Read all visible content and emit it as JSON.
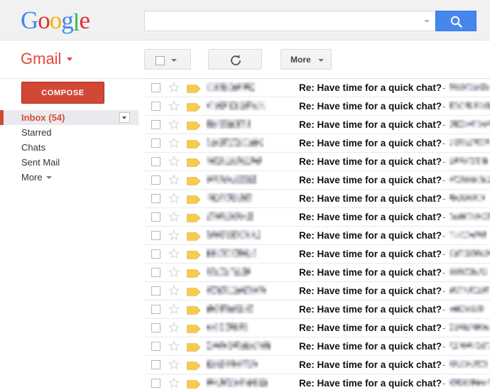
{
  "header": {
    "logo": {
      "text": "Google",
      "letters": [
        {
          "ch": "G",
          "color": "#4285f4"
        },
        {
          "ch": "o",
          "color": "#db3236"
        },
        {
          "ch": "o",
          "color": "#f4b400"
        },
        {
          "ch": "g",
          "color": "#4285f4"
        },
        {
          "ch": "l",
          "color": "#3cba54"
        },
        {
          "ch": "e",
          "color": "#db3236"
        }
      ]
    },
    "search": {
      "value": "",
      "placeholder": "",
      "button_icon": "search-icon",
      "options_icon": "chevron-down-icon"
    }
  },
  "app": {
    "name": "Gmail",
    "name_color": "#dd4b39",
    "caret_icon": "chevron-down-icon"
  },
  "toolbar": {
    "select_all": {
      "icon": "checkbox-icon",
      "caret": "chevron-down-icon"
    },
    "refresh": {
      "icon": "refresh-icon",
      "label": ""
    },
    "more": {
      "label": "More",
      "caret": "chevron-down-icon"
    }
  },
  "sidebar": {
    "compose_label": "COMPOSE",
    "compose_color": "#d14836",
    "items": [
      {
        "label": "Inbox (54)",
        "active": true,
        "has_dropdown": true
      },
      {
        "label": "Starred",
        "active": false,
        "has_dropdown": false
      },
      {
        "label": "Chats",
        "active": false,
        "has_dropdown": false
      },
      {
        "label": "Sent Mail",
        "active": false,
        "has_dropdown": false
      },
      {
        "label": "More",
        "active": false,
        "has_dropdown": false,
        "caret": true
      }
    ]
  },
  "mail": {
    "subject": "Re: Have time for a quick chat?",
    "separator": "-",
    "label_color": "#f7cb4d",
    "rows": [
      {
        "sender_w": 68,
        "sender_redacted": true,
        "snippet_w": 56
      },
      {
        "sender_w": 84,
        "sender_redacted": true,
        "snippet_w": 58
      },
      {
        "sender_w": 62,
        "sender_redacted": true,
        "snippet_w": 60
      },
      {
        "sender_w": 80,
        "sender_redacted": true,
        "snippet_w": 56
      },
      {
        "sender_w": 78,
        "sender_redacted": true,
        "snippet_w": 54
      },
      {
        "sender_w": 70,
        "sender_redacted": true,
        "snippet_w": 58
      },
      {
        "sender_w": 64,
        "sender_redacted": true,
        "snippet_w": 50
      },
      {
        "sender_w": 66,
        "sender_redacted": true,
        "snippet_w": 58
      },
      {
        "sender_w": 76,
        "sender_redacted": true,
        "snippet_w": 52
      },
      {
        "sender_w": 70,
        "sender_redacted": true,
        "snippet_w": 58
      },
      {
        "sender_w": 62,
        "sender_redacted": true,
        "snippet_w": 54
      },
      {
        "sender_w": 84,
        "sender_redacted": true,
        "snippet_w": 56
      },
      {
        "sender_w": 66,
        "sender_redacted": true,
        "snippet_w": 50
      },
      {
        "sender_w": 58,
        "sender_redacted": true,
        "snippet_w": 56
      },
      {
        "sender_w": 90,
        "sender_redacted": true,
        "snippet_w": 58
      },
      {
        "sender_w": 72,
        "sender_redacted": true,
        "snippet_w": 54
      },
      {
        "sender_w": 86,
        "sender_redacted": true,
        "snippet_w": 58
      }
    ]
  }
}
